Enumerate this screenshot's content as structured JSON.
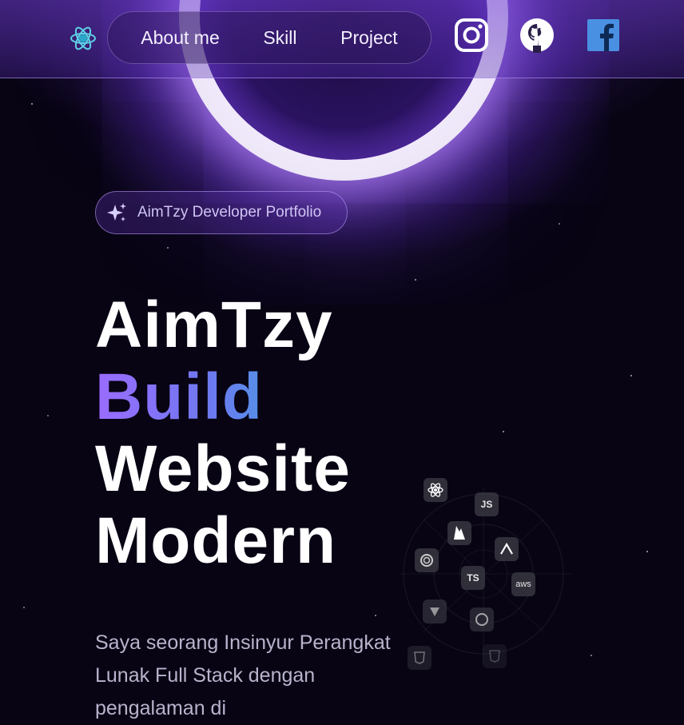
{
  "nav": {
    "links": [
      "About me",
      "Skill",
      "Project"
    ]
  },
  "social": [
    "instagram-icon",
    "github-icon",
    "facebook-icon"
  ],
  "badge": {
    "text": "AimTzy Developer Portfolio"
  },
  "hero": {
    "line1": "AimTzy",
    "line2": "Build",
    "line3": "Website",
    "line4": "Modern"
  },
  "description": "Saya seorang Insinyur Perangkat Lunak Full Stack dengan pengalaman di",
  "tech_tiles": [
    "JS",
    "TS",
    "aws"
  ],
  "colors": {
    "accent": "#9b6cff",
    "accent2": "#2fb3d8",
    "facebook": "#4a90e2",
    "background": "#080414"
  }
}
